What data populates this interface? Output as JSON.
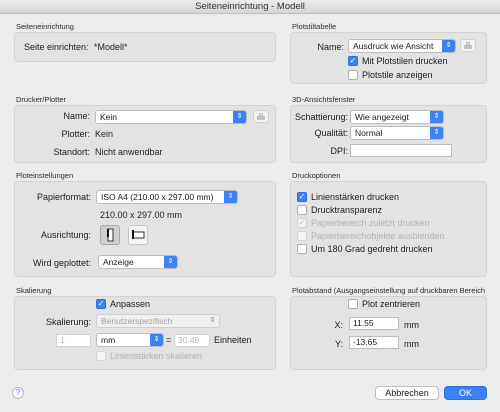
{
  "window": {
    "title": "Seiteneinrichtung - Modell"
  },
  "seiteneinrichtung": {
    "header": "Seiteneinrichtung",
    "label": "Seite einrichten:",
    "value": "*Modell*"
  },
  "drucker": {
    "header": "Drucker/Plotter",
    "name_label": "Name:",
    "name_value": "Kein",
    "plotter_label": "Plotter:",
    "plotter_value": "Kein",
    "standort_label": "Standort:",
    "standort_value": "Nicht anwendbar"
  },
  "ploteinstellungen": {
    "header": "Ploteinstellungen",
    "papierformat_label": "Papierformat:",
    "papierformat_value": "ISO A4 (210.00 x 297.00 mm)",
    "size_text": "210.00 x 297.00 mm",
    "ausrichtung_label": "Ausrichtung:",
    "wird_label": "Wird geplottet:",
    "wird_value": "Anzeige"
  },
  "skalierung": {
    "header": "Skalierung",
    "anpassen_label": "Anpassen",
    "anpassen_checked": true,
    "skalierung_label": "Skalierung:",
    "skalierung_value": "Benutzerspezifisch",
    "scale_left": "1",
    "unit_value": "mm",
    "equals": "=",
    "scale_right": "30.49",
    "einheiten_label": "Einheiten",
    "linien_label": "Linienstärken skalieren"
  },
  "plotstiltabelle": {
    "header": "Plotstiltabelle",
    "name_label": "Name:",
    "name_value": "Ausdruck wie Ansicht",
    "mit_label": "Mit Plotstilen drucken",
    "mit_checked": true,
    "anzeigen_label": "Plotstile anzeigen",
    "anzeigen_checked": false
  },
  "ansicht3d": {
    "header": "3D-Ansichtsfenster",
    "schattierung_label": "Schattierung:",
    "schattierung_value": "Wie angezeigt",
    "qualitaet_label": "Qualität:",
    "qualitaet_value": "Normal",
    "dpi_label": "DPI:",
    "dpi_value": ""
  },
  "druckoptionen": {
    "header": "Druckoptionen",
    "options": [
      {
        "label": "Linienstärken drucken",
        "checked": true,
        "enabled": true
      },
      {
        "label": "Drucktransparenz",
        "checked": false,
        "enabled": true
      },
      {
        "label": "Papierbereich zuletzt drucken",
        "checked": true,
        "enabled": false
      },
      {
        "label": "Papierbereichobjekte ausblenden",
        "checked": false,
        "enabled": false
      },
      {
        "label": "Um 180 Grad gedreht drucken",
        "checked": false,
        "enabled": true
      }
    ]
  },
  "plotabstand": {
    "header": "Plotabstand (Ausgangseinstellung auf druckbaren Bereich",
    "zentrieren_label": "Plot zentrieren",
    "zentrieren_checked": false,
    "x_label": "X:",
    "x_value": "11.55",
    "x_unit": "mm",
    "y_label": "Y:",
    "y_value": "-13.65",
    "y_unit": "mm"
  },
  "footer": {
    "help": "?",
    "cancel": "Abbrechen",
    "ok": "OK"
  },
  "icons": {
    "help": "help-icon",
    "printer": "printer-properties-icon",
    "portrait": "portrait-orientation-icon",
    "landscape": "landscape-orientation-icon"
  },
  "colors": {
    "accent": "#3c82f6"
  }
}
